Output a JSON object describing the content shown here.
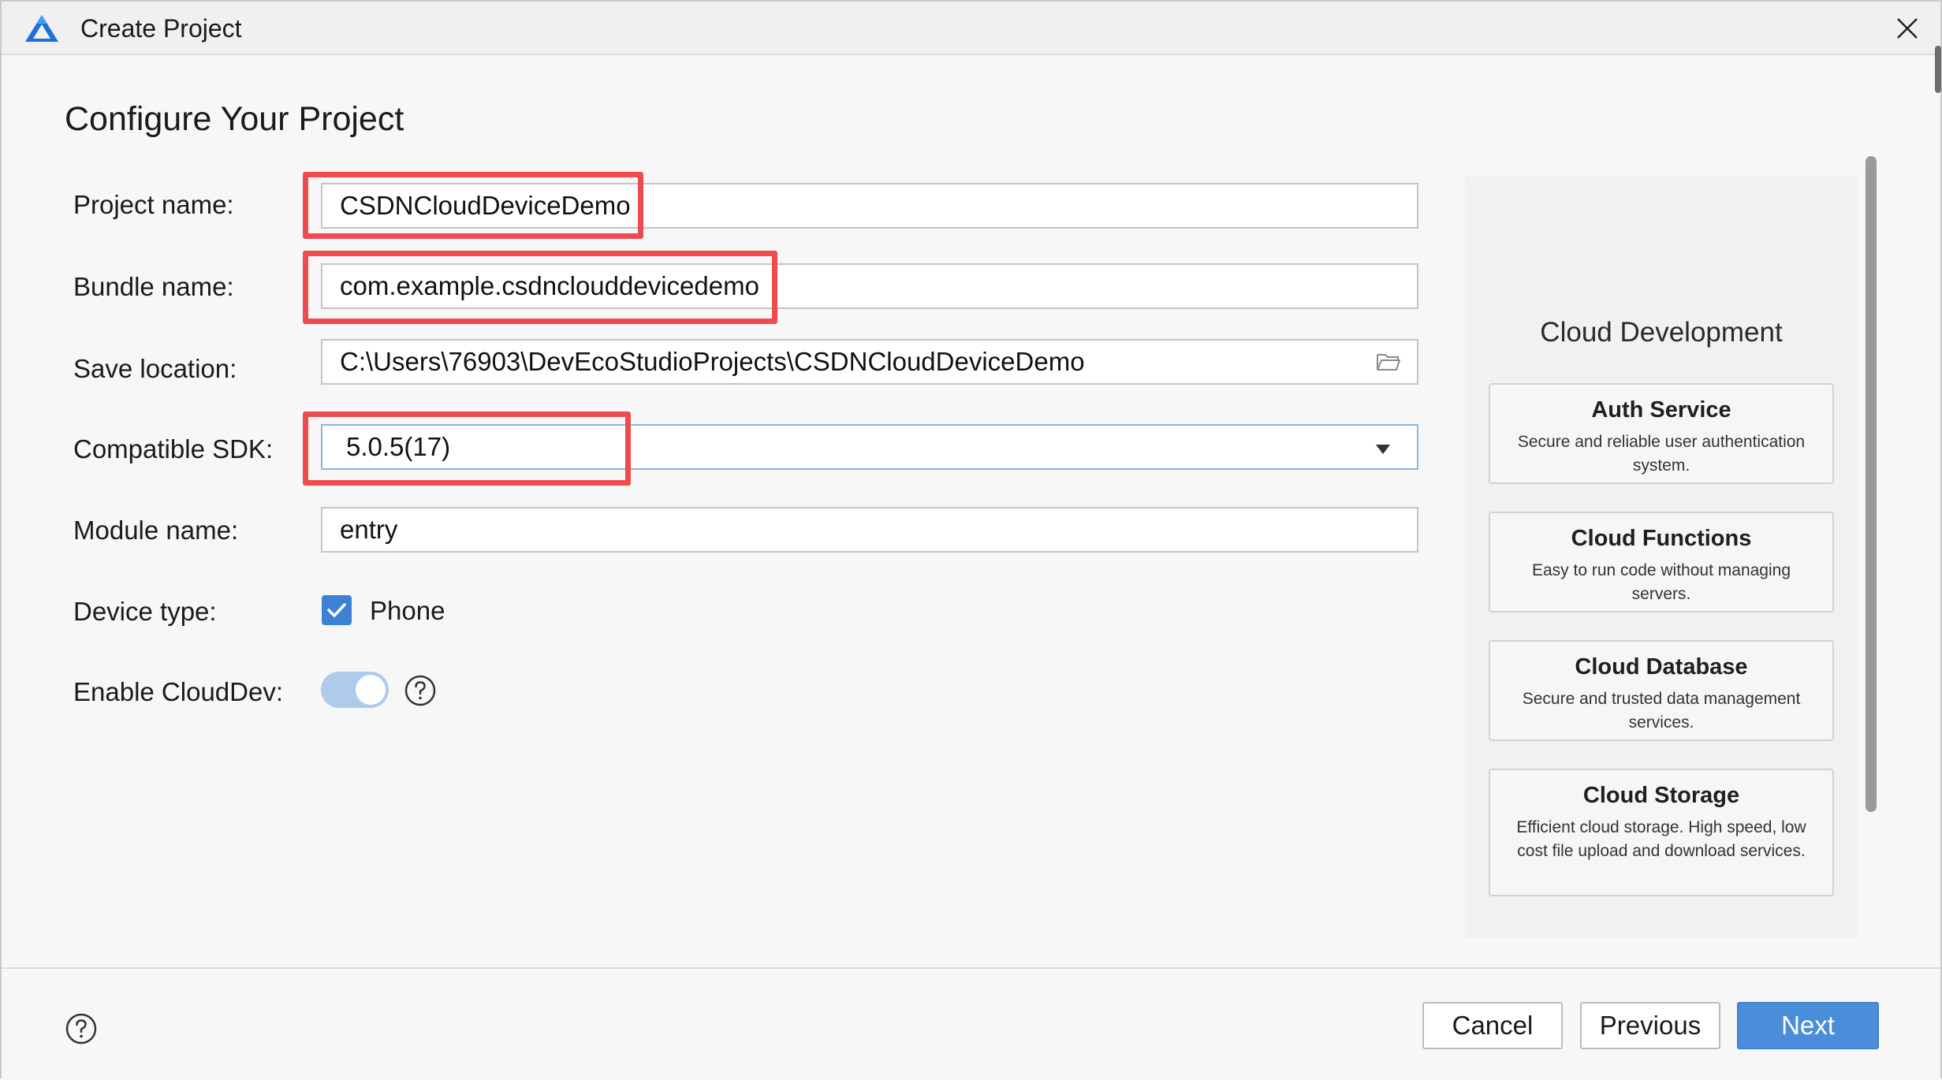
{
  "window": {
    "title": "Create Project",
    "icons": {
      "app": "deveco-triangle-logo",
      "close": "close-icon"
    }
  },
  "heading": "Configure Your Project",
  "form": {
    "project_name": {
      "label": "Project name:",
      "value": "CSDNCloudDeviceDemo"
    },
    "bundle_name": {
      "label": "Bundle name:",
      "value": "com.example.csdnclouddevicedemo"
    },
    "save_location": {
      "label": "Save location:",
      "value": "C:\\Users\\76903\\DevEcoStudioProjects\\CSDNCloudDeviceDemo",
      "icon": "folder-icon"
    },
    "compatible_sdk": {
      "label": "Compatible SDK:",
      "value": "5.0.5(17)",
      "icon": "dropdown-arrow-icon"
    },
    "module_name": {
      "label": "Module name:",
      "value": "entry"
    },
    "device_type": {
      "label": "Device type:",
      "option": "Phone",
      "checked": true
    },
    "enable_clouddev": {
      "label": "Enable CloudDev:",
      "enabled": true,
      "help_icon": "help-icon"
    }
  },
  "side_panel": {
    "title": "Cloud Development",
    "cards": [
      {
        "title": "Auth Service",
        "desc": "Secure and reliable user authentication system."
      },
      {
        "title": "Cloud Functions",
        "desc": "Easy to run code without managing servers."
      },
      {
        "title": "Cloud Database",
        "desc": "Secure and trusted data management services."
      },
      {
        "title": "Cloud Storage",
        "desc": "Efficient cloud storage. High speed, low cost file upload and download services."
      }
    ]
  },
  "footer": {
    "cancel": "Cancel",
    "previous": "Previous",
    "next": "Next",
    "help_icon": "help-icon"
  },
  "colors": {
    "highlight": "#ef4b4f",
    "primary": "#4a8ed9",
    "toggle_on": "#aecbec",
    "checkbox": "#3b82d6"
  }
}
